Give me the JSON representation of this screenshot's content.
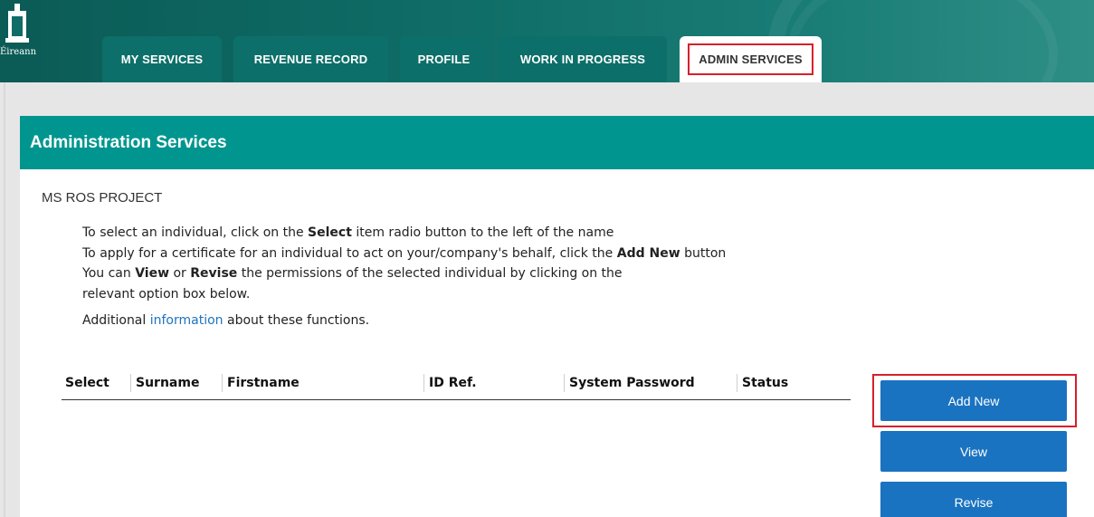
{
  "header": {
    "logo_text": "Éireann",
    "tabs": [
      {
        "label": "MY SERVICES"
      },
      {
        "label": "REVENUE RECORD"
      },
      {
        "label": "PROFILE"
      },
      {
        "label": "WORK IN PROGRESS"
      },
      {
        "label": "ADMIN SERVICES",
        "active": true
      }
    ]
  },
  "panel": {
    "title": "Administration Services",
    "project": "MS ROS PROJECT",
    "line1": {
      "pre": "To select an individual, click on the ",
      "bold": "Select",
      "post": " item radio button to the left of the name"
    },
    "line2": {
      "pre": "To apply for a certificate for an individual to act on your/company's behalf, click the ",
      "bold": "Add New",
      "post": " button"
    },
    "line3": {
      "pre": "You can ",
      "bold1": "View",
      "mid": " or ",
      "bold2": "Revise",
      "post": " the permissions of the selected individual by clicking on the"
    },
    "line4": "relevant option box below.",
    "line5": {
      "pre": "Additional ",
      "link": "information",
      "post": " about these functions."
    }
  },
  "table": {
    "columns": [
      "Select",
      "Surname",
      "Firstname",
      "ID Ref.",
      "System Password",
      "Status"
    ],
    "rows": []
  },
  "actions": {
    "add_new": "Add New",
    "view": "View",
    "revise": "Revise"
  },
  "colors": {
    "header": "#0f6c66",
    "panel_header": "#00968f",
    "button": "#1a73c0",
    "highlight": "#d6202b"
  }
}
